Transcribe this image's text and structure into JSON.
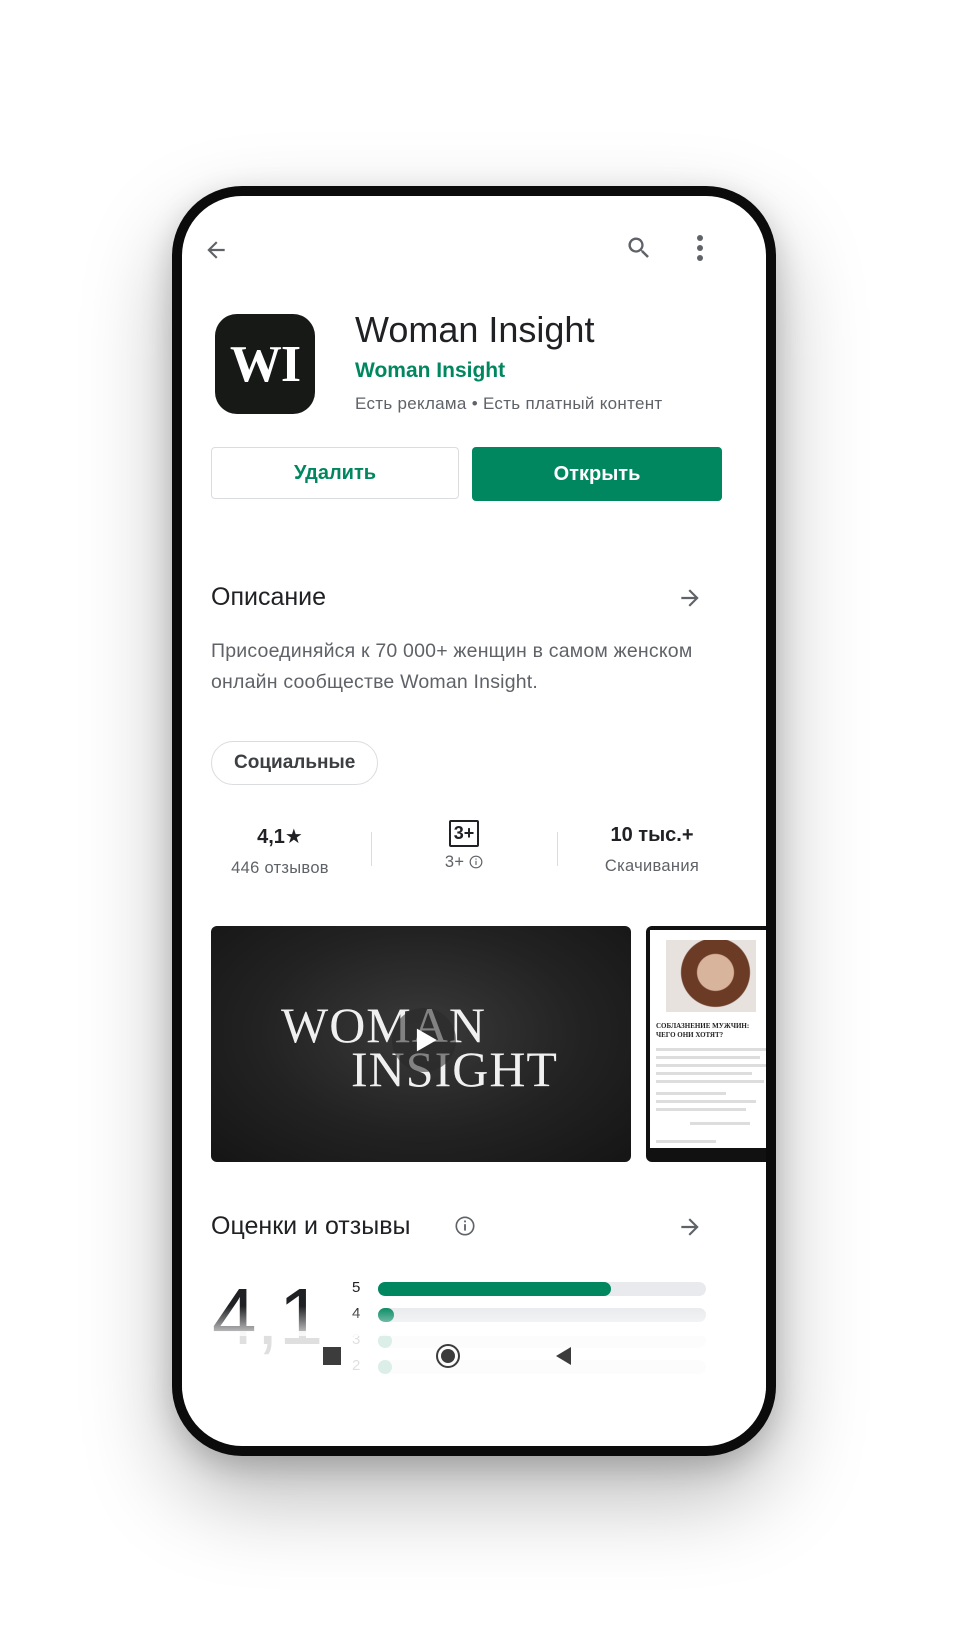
{
  "topbar": {
    "back_icon": "arrow-back-icon",
    "search_icon": "search-icon",
    "more_icon": "more-vert-icon"
  },
  "app": {
    "icon_text": "WI",
    "title": "Woman Insight",
    "developer": "Woman Insight",
    "meta": "Есть реклама  •  Есть платный контент"
  },
  "actions": {
    "uninstall_label": "Удалить",
    "open_label": "Открыть"
  },
  "description": {
    "title": "Описание",
    "text": "Присоединяйся к 70 000+ женщин в самом женском онлайн сообществе Woman Insight.",
    "category_chip": "Социальные"
  },
  "stats": {
    "rating_value": "4,1★",
    "reviews_label": "446 отзывов",
    "age_badge": "3+",
    "age_label": "3+",
    "downloads_value": "10 тыс.+",
    "downloads_label": "Скачивания"
  },
  "media": {
    "video_brand_line1": "WOMAN",
    "video_brand_line2": "INSIGHT",
    "screenshot_headline": "СОБЛАЗНЕНИЕ МУЖЧИН: ЧЕГО ОНИ ХОТЯТ?"
  },
  "ratings": {
    "title": "Оценки и отзывы",
    "average": "4,1",
    "bars": [
      {
        "label": "5",
        "fraction": 0.71
      },
      {
        "label": "4",
        "fraction": 0.05
      },
      {
        "label": "3",
        "fraction": 0.03
      },
      {
        "label": "2",
        "fraction": 0.03
      }
    ]
  },
  "colors": {
    "accent": "#01875f",
    "text_primary": "#202124",
    "text_secondary": "#5f6368"
  }
}
